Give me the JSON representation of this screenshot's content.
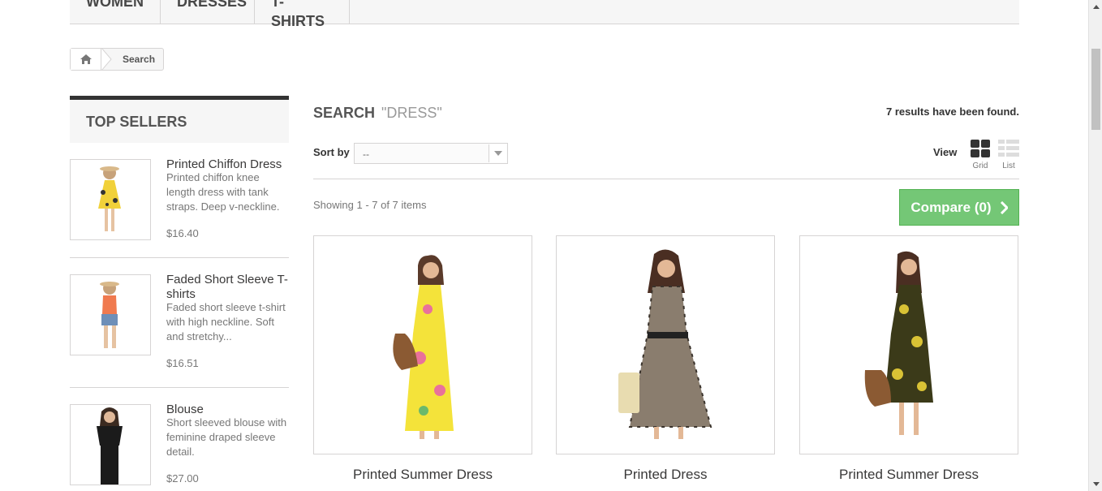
{
  "nav": {
    "tabs": [
      {
        "label": "WOMEN"
      },
      {
        "label": "DRESSES"
      },
      {
        "label": "T-SHIRTS"
      }
    ]
  },
  "breadcrumb": {
    "home_icon": "home-icon",
    "current": "Search"
  },
  "sidebar": {
    "title": "TOP SELLERS",
    "items": [
      {
        "name": "Printed Chiffon Dress",
        "desc": "Printed chiffon knee length dress with tank straps. Deep v-neckline.",
        "price": "$16.40",
        "dress_color": "#f1d13a",
        "accent": "#333"
      },
      {
        "name": "Faded Short Sleeve T-shirts",
        "desc": "Faded short sleeve t-shirt with high neckline. Soft and stretchy...",
        "price": "$16.51",
        "dress_color": "#f07a4f",
        "accent": "#6e8fb8"
      },
      {
        "name": "Blouse",
        "desc": "Short sleeved blouse with feminine draped sleeve detail.",
        "price": "$27.00",
        "dress_color": "#1b1b1b",
        "accent": "#1b1b1b"
      }
    ]
  },
  "main": {
    "heading": "SEARCH",
    "query": "\"DRESS\"",
    "results": "7 results have been found.",
    "sort_label": "Sort by",
    "sort_value": "--",
    "view_label": "View",
    "grid_label": "Grid",
    "list_label": "List",
    "showing": "Showing 1 - 7 of 7 items",
    "compare": "Compare (0)"
  },
  "products": [
    {
      "name": "Printed Summer Dress",
      "dress_color": "#f4e33a",
      "pattern_color": "#e9719b"
    },
    {
      "name": "Printed Dress",
      "dress_color": "#8a7d6e",
      "pattern_color": "#3a332c"
    },
    {
      "name": "Printed Summer Dress",
      "dress_color": "#3b3a19",
      "pattern_color": "#d9c235"
    }
  ],
  "colors": {
    "accent_green": "#74c776",
    "border": "#d6d4d4"
  }
}
